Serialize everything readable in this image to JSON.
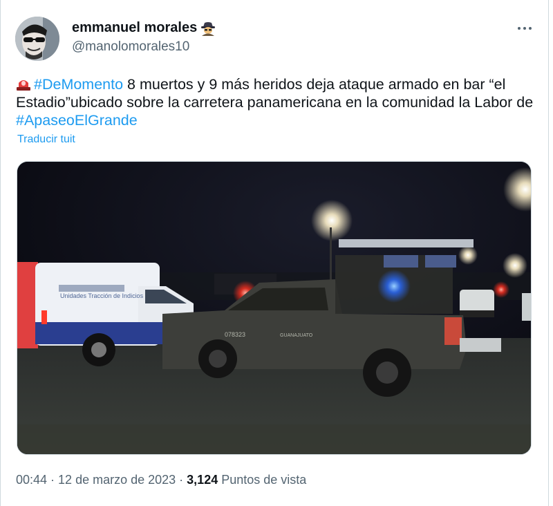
{
  "author": {
    "display_name": "emmanuel morales",
    "handle": "@manolomorales10"
  },
  "tweet": {
    "hashtag1": "#DeMomento",
    "text_part1": " 8 muertos y 9 más heridos deja ataque armado en bar “el Estadio”ubicado sobre la carretera panamericana en la comunidad la Labor de ",
    "hashtag2": "#ApaseoElGrande",
    "translate_label": "Traducir tuit"
  },
  "media": {
    "van_label": "Unidades Tracción de Indicios",
    "truck_label_left": "078323",
    "truck_label_right": "GUANAJUATO"
  },
  "meta": {
    "time": "00:44",
    "separator1": " · ",
    "date": "12 de marzo de 2023",
    "separator2": " · ",
    "views_count": "3,124",
    "views_label": " Puntos de vista"
  },
  "icons": {
    "avatar": "avatar-person-sunglasses",
    "emoji_name": "spy-emoji",
    "emoji_text": "police-siren-emoji",
    "more": "more-dots-icon"
  }
}
